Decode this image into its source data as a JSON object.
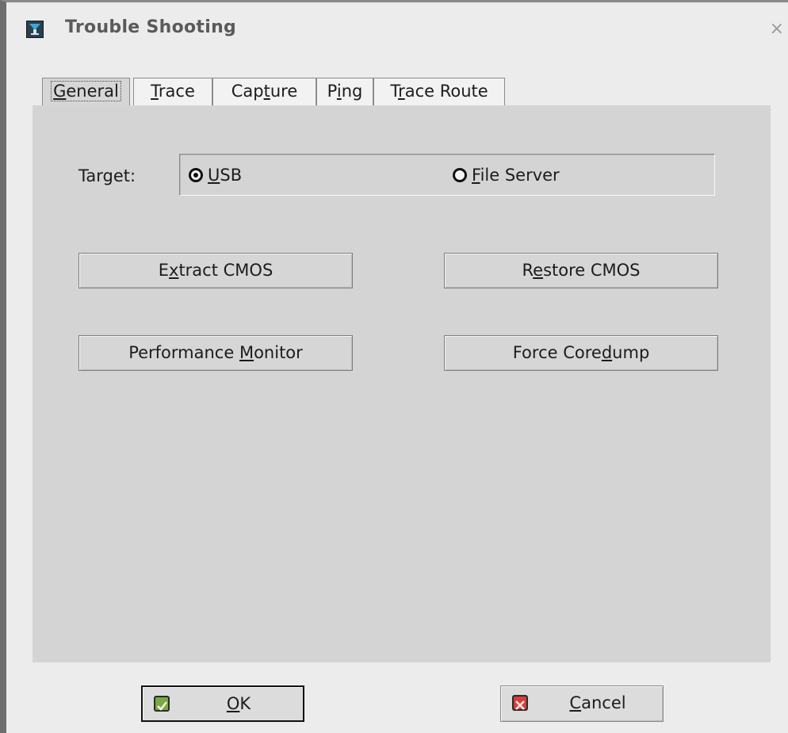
{
  "window": {
    "title": "Trouble Shooting",
    "close_glyph": "×",
    "icon": "troubleshoot-app-icon"
  },
  "tabs": [
    {
      "label": "General",
      "mnemonic_index": 0,
      "active": true
    },
    {
      "label": "Trace",
      "mnemonic_index": 0,
      "active": false
    },
    {
      "label": "Capture",
      "mnemonic_index": 3,
      "active": false
    },
    {
      "label": "Ping",
      "mnemonic_index": 1,
      "active": false
    },
    {
      "label": "Trace Route",
      "mnemonic_index": 1,
      "active": false
    }
  ],
  "general": {
    "target_label": "Target:",
    "target_options": [
      {
        "label": "USB",
        "mnemonic_index": 0,
        "checked": true
      },
      {
        "label": "File Server",
        "mnemonic_index": 0,
        "checked": false
      }
    ],
    "buttons": {
      "extract_cmos": {
        "label": "Extract CMOS",
        "mnemonic_index": 1
      },
      "restore_cmos": {
        "label": "Restore CMOS",
        "mnemonic_index": 1
      },
      "performance_monitor": {
        "label": "Performance Monitor",
        "mnemonic_index": 12
      },
      "force_coredump": {
        "label": "Force Coredump",
        "mnemonic_index": 10
      }
    }
  },
  "footer": {
    "ok": {
      "label": "OK",
      "mnemonic_index": 0,
      "icon": "checkmark-icon"
    },
    "cancel": {
      "label": "Cancel",
      "mnemonic_index": 0,
      "icon": "cancel-x-icon"
    }
  },
  "colors": {
    "panel": "#d4d4d4",
    "window": "#ececec",
    "ok_icon": "#7aa843",
    "cancel_icon": "#d2403b"
  }
}
